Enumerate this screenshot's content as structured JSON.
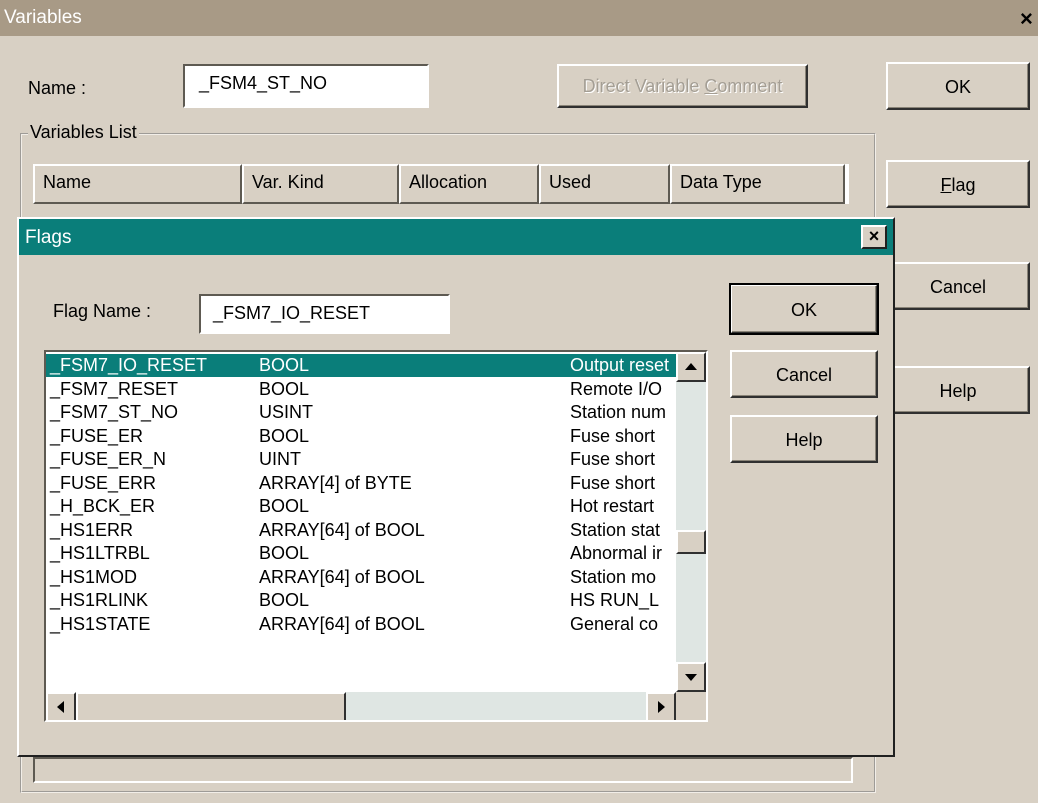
{
  "variables_window": {
    "title": "Variables",
    "close_glyph": "×",
    "name_label": "Name :",
    "name_value": "_FSM4_ST_NO",
    "direct_comment_label": "Direct Variable Comment",
    "direct_comment_access_key": "C",
    "variables_list_label": "Variables List",
    "columns": [
      "Name",
      "Var. Kind",
      "Allocation",
      "Used",
      "Data Type"
    ],
    "ok_label": "OK",
    "flag_label": "Flag",
    "flag_access_key": "F",
    "cancel_label": "Cancel",
    "help_label": "Help"
  },
  "flags_dialog": {
    "title": "Flags",
    "close_glyph": "×",
    "flag_name_label": "Flag Name :",
    "flag_name_value": "_FSM7_IO_RESET",
    "ok_label": "OK",
    "cancel_label": "Cancel",
    "help_label": "Help",
    "selected_index": 0,
    "rows": [
      {
        "name": "_FSM7_IO_RESET",
        "type": "BOOL",
        "desc": "Output reset"
      },
      {
        "name": "_FSM7_RESET",
        "type": "BOOL",
        "desc": "Remote I/O"
      },
      {
        "name": "_FSM7_ST_NO",
        "type": "USINT",
        "desc": "Station num"
      },
      {
        "name": "_FUSE_ER",
        "type": "BOOL",
        "desc": "Fuse short"
      },
      {
        "name": "_FUSE_ER_N",
        "type": "UINT",
        "desc": "Fuse short"
      },
      {
        "name": "_FUSE_ERR",
        "type": "ARRAY[4] of BYTE",
        "desc": "Fuse short"
      },
      {
        "name": "_H_BCK_ER",
        "type": "BOOL",
        "desc": "Hot restart"
      },
      {
        "name": "_HS1ERR",
        "type": "ARRAY[64] of BOOL",
        "desc": "Station stat"
      },
      {
        "name": "_HS1LTRBL",
        "type": "BOOL",
        "desc": "Abnormal ir"
      },
      {
        "name": "_HS1MOD",
        "type": "ARRAY[64] of BOOL",
        "desc": "Station mo"
      },
      {
        "name": "_HS1RLINK",
        "type": "BOOL",
        "desc": "HS RUN_L"
      },
      {
        "name": "_HS1STATE",
        "type": "ARRAY[64] of BOOL",
        "desc": "General co"
      }
    ]
  }
}
